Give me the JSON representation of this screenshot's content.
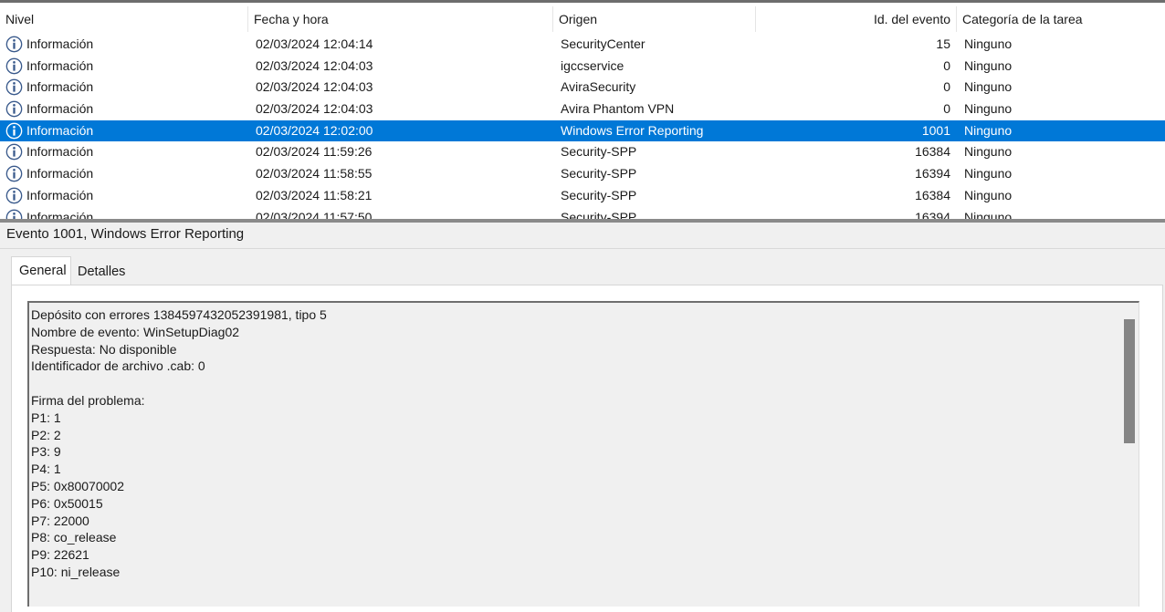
{
  "event_list": {
    "columns": {
      "level": "Nivel",
      "date": "Fecha y hora",
      "source": "Origen",
      "event_id": "Id. del evento",
      "task_category": "Categoría de la tarea"
    },
    "rows": [
      {
        "level": "Información",
        "date": "02/03/2024 12:04:14",
        "source": "SecurityCenter",
        "event_id": "15",
        "task_category": "Ninguno",
        "selected": false
      },
      {
        "level": "Información",
        "date": "02/03/2024 12:04:03",
        "source": "igccservice",
        "event_id": "0",
        "task_category": "Ninguno",
        "selected": false
      },
      {
        "level": "Información",
        "date": "02/03/2024 12:04:03",
        "source": "AviraSecurity",
        "event_id": "0",
        "task_category": "Ninguno",
        "selected": false
      },
      {
        "level": "Información",
        "date": "02/03/2024 12:04:03",
        "source": "Avira Phantom VPN",
        "event_id": "0",
        "task_category": "Ninguno",
        "selected": false
      },
      {
        "level": "Información",
        "date": "02/03/2024 12:02:00",
        "source": "Windows Error Reporting",
        "event_id": "1001",
        "task_category": "Ninguno",
        "selected": true
      },
      {
        "level": "Información",
        "date": "02/03/2024 11:59:26",
        "source": "Security-SPP",
        "event_id": "16384",
        "task_category": "Ninguno",
        "selected": false
      },
      {
        "level": "Información",
        "date": "02/03/2024 11:58:55",
        "source": "Security-SPP",
        "event_id": "16394",
        "task_category": "Ninguno",
        "selected": false
      },
      {
        "level": "Información",
        "date": "02/03/2024 11:58:21",
        "source": "Security-SPP",
        "event_id": "16384",
        "task_category": "Ninguno",
        "selected": false
      },
      {
        "level": "Información",
        "date": "02/03/2024 11:57:50",
        "source": "Security-SPP",
        "event_id": "16394",
        "task_category": "Ninguno",
        "selected": false
      }
    ],
    "level_icon": "info-icon"
  },
  "detail": {
    "title": "Evento 1001, Windows Error Reporting",
    "tabs": {
      "general": "General",
      "details": "Detalles"
    },
    "description_lines": [
      "Depósito con errores 1384597432052391981, tipo 5",
      "Nombre de evento: WinSetupDiag02",
      "Respuesta: No disponible",
      "Identificador de archivo .cab: 0",
      "",
      "Firma del problema:",
      "P1: 1",
      "P2: 2",
      "P3: 9",
      "P4: 1",
      "P5: 0x80070002",
      "P6: 0x50015",
      "P7: 22000",
      "P8: co_release",
      "P9: 22621",
      "P10: ni_release"
    ]
  },
  "colors": {
    "selection": "#0078d7",
    "info_icon_stroke": "#3a5a8c"
  }
}
